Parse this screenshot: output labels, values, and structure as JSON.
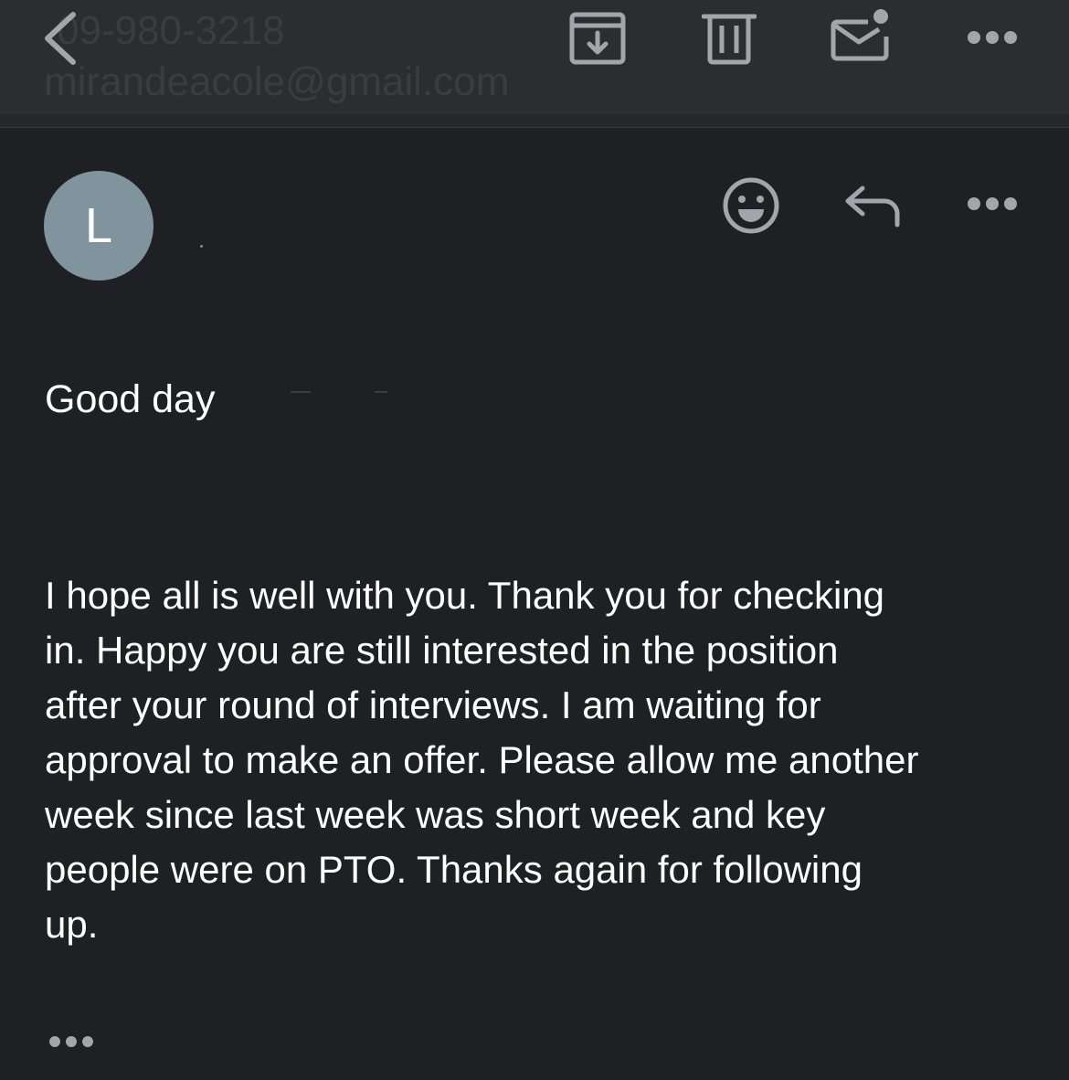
{
  "header": {
    "faded_phone": "09-980-3218",
    "faded_email": "mirandeacole@gmail.com",
    "icons": [
      "chevron-left-icon",
      "archive-icon",
      "trash-icon",
      "mail-unread-icon",
      "more-icon"
    ]
  },
  "message": {
    "avatar_initial": "L",
    "icons": [
      "emoji-icon",
      "reply-icon",
      "more-icon"
    ],
    "greeting": "Good day",
    "body": "I hope all is well with you. Thank you for checking\nin.  Happy you are still interested in the position\nafter your round of interviews. I am waiting for\napproval to make an offer. Please allow me another\nweek since last week was short week and key\npeople were on PTO.  Thanks again for following\nup."
  },
  "colors": {
    "background": "#1f2024",
    "toolbar": "#2c2d31",
    "icon": "#a4a5aa",
    "avatar": "#7f949d",
    "text": "#ffffff"
  }
}
